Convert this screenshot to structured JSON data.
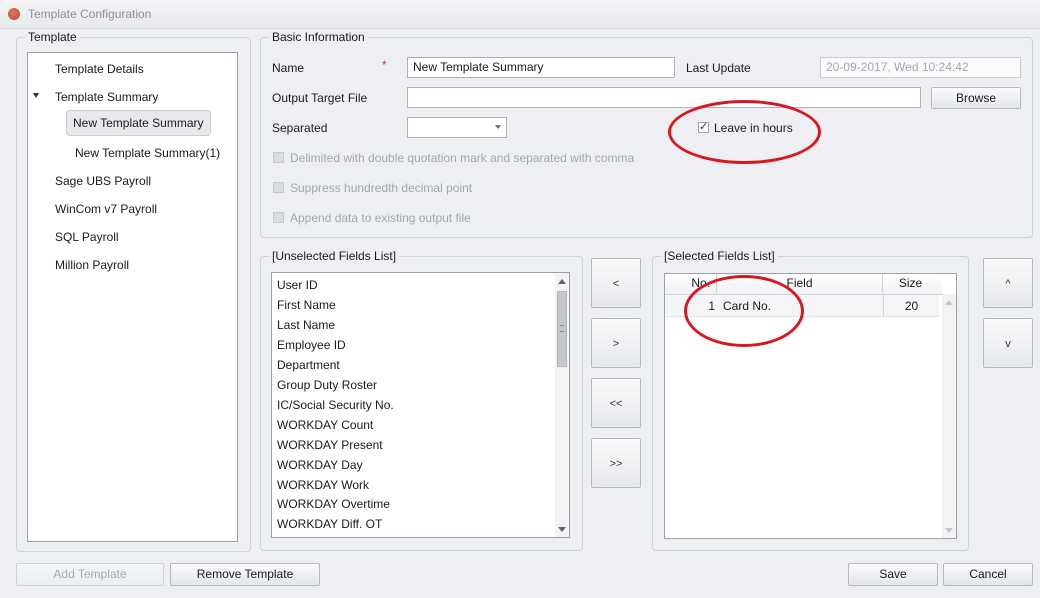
{
  "window": {
    "title": "Template Configuration"
  },
  "template_panel": {
    "legend": "Template",
    "items": [
      {
        "label": "Template Details",
        "level": 0
      },
      {
        "label": "Template Summary",
        "level": 0,
        "expanded": true
      },
      {
        "label": "New Template Summary",
        "level": 1,
        "selected": true
      },
      {
        "label": "New Template Summary(1)",
        "level": 1
      },
      {
        "label": "Sage UBS Payroll",
        "level": 0
      },
      {
        "label": "WinCom v7 Payroll",
        "level": 0
      },
      {
        "label": "SQL Payroll",
        "level": 0
      },
      {
        "label": "Million Payroll",
        "level": 0
      }
    ]
  },
  "basic_info": {
    "legend": "Basic Information",
    "name_label": "Name",
    "required_mark": "*",
    "name_value": "New Template Summary",
    "last_update_label": "Last Update",
    "last_update_value": "20-09-2017, Wed  10:24:42",
    "output_label": "Output Target File",
    "output_value": "",
    "browse_label": "Browse",
    "separated_label": "Separated",
    "separated_value": "",
    "leave_in_hours_label": "Leave in hours",
    "leave_in_hours_checked": true,
    "delimited_label": "Delimited with double quotation mark and separated with comma",
    "suppress_label": "Suppress hundredth decimal point",
    "append_label": "Append data to existing output file"
  },
  "unselected": {
    "legend": "[Unselected Fields List]",
    "items": [
      "User ID",
      "First Name",
      "Last Name",
      "Employee ID",
      "Department",
      "Group Duty Roster",
      "IC/Social Security No.",
      "WORKDAY Count",
      "WORKDAY Present",
      "WORKDAY Day",
      "WORKDAY Work",
      "WORKDAY Overtime",
      "WORKDAY Diff. OT"
    ]
  },
  "move_buttons": {
    "add_one": "<",
    "remove_one": ">",
    "add_all": "<<",
    "remove_all": ">>"
  },
  "selected": {
    "legend": "[Selected Fields List]",
    "columns": [
      "No.",
      "Field",
      "Size"
    ],
    "rows": [
      {
        "no": "1",
        "field": "Card No.",
        "size": "20"
      }
    ]
  },
  "order_buttons": {
    "up": "^",
    "down": "v"
  },
  "footer": {
    "add_template": "Add Template",
    "remove_template": "Remove Template",
    "save": "Save",
    "cancel": "Cancel"
  },
  "colors": {
    "annotation": "#d9171e",
    "required": "#d63b3b"
  }
}
